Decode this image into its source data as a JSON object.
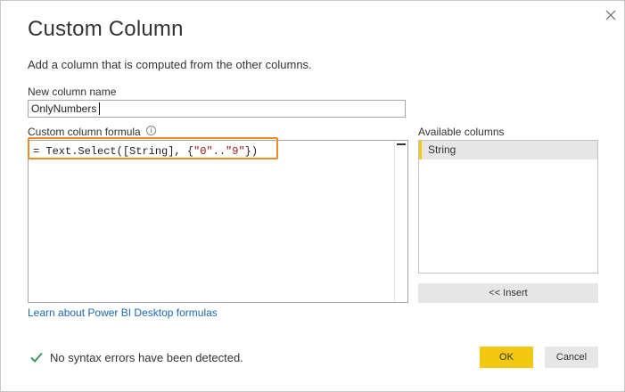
{
  "dialog": {
    "title": "Custom Column",
    "subtitle": "Add a column that is computed from the other columns.",
    "close_icon": "close-icon"
  },
  "new_column": {
    "label": "New column name",
    "value": "OnlyNumbers"
  },
  "formula": {
    "label": "Custom column formula",
    "info_icon": "info-icon",
    "prefix": "= Text.Select([String], {",
    "str1": "\"0\"",
    "middle": "..",
    "str2": "\"9\"",
    "suffix": "})",
    "highlight_color": "#f08a24"
  },
  "available": {
    "label": "Available columns",
    "items": [
      "String"
    ],
    "insert_label": "<< Insert"
  },
  "learn_link": "Learn about Power BI Desktop formulas",
  "status": {
    "icon": "checkmark-icon",
    "text": "No syntax errors have been detected.",
    "color": "#3c9a5f"
  },
  "buttons": {
    "ok": "OK",
    "cancel": "Cancel",
    "ok_color": "#f2c811"
  }
}
